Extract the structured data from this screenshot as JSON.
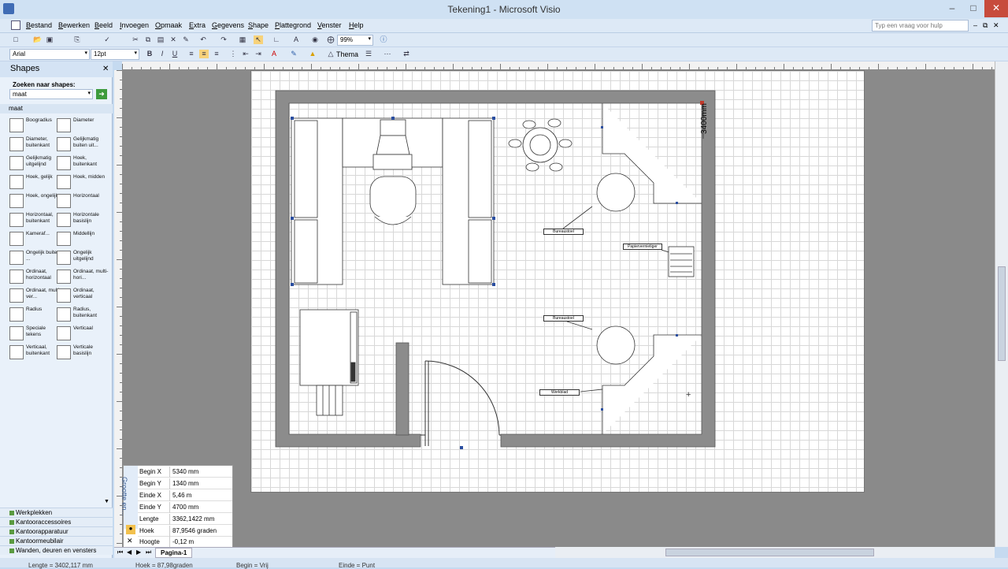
{
  "window": {
    "title": "Tekening1 - Microsoft Visio"
  },
  "menu": {
    "items": [
      "Bestand",
      "Bewerken",
      "Beeld",
      "Invoegen",
      "Opmaak",
      "Extra",
      "Gegevens",
      "Shape",
      "Plattegrond",
      "Venster",
      "Help"
    ],
    "help_placeholder": "Typ een vraag voor hulp"
  },
  "toolbar": {
    "zoom": "99%",
    "font": "Arial",
    "font_size": "12pt",
    "bold": "B",
    "italic": "I",
    "underline": "U",
    "theme": "Thema"
  },
  "shapes_panel": {
    "title": "Shapes",
    "search_label": "Zoeken naar shapes:",
    "search_value": "maat",
    "stencil_name": "maat",
    "items": [
      "Boogradius",
      "Diameter",
      "Diameter, buitenkant",
      "Gelijkmatig buiten uit...",
      "Gelijkmatig uitgelijnd",
      "Hoek, buitenkant",
      "Hoek, gelijk",
      "Hoek, midden",
      "Hoek, ongelijk",
      "Horizontaal",
      "Horizontaal, buitenkant",
      "Horizontale basislijn",
      "Kameraf...",
      "Middellijn",
      "Ongelijk buiten ...",
      "Ongelijk uitgelijnd",
      "Ordinaat, horizontaal",
      "Ordinaat, multi-hori...",
      "Ordinaat, multi-ver...",
      "Ordinaat, verticaal",
      "Radius",
      "Radius, buitenkant",
      "Speciale tekens",
      "Verticaal",
      "Verticaal, buitenkant",
      "Verticale basislijn"
    ],
    "stencils": [
      "Werkplekken",
      "Kantooraccessoires",
      "Kantoorapparatuur",
      "Kantoormeubilair",
      "Wanden, deuren en vensters"
    ]
  },
  "drawing": {
    "labels": {
      "desk1": "Bureaustoel",
      "desk2": "Bureaustoel",
      "shredder": "Papiervernietiger",
      "workbench": "Werkblad",
      "dimension": "3400mm"
    }
  },
  "size_panel": {
    "title": "Grootte en...",
    "rows": [
      {
        "key": "Begin X",
        "value": "5340 mm"
      },
      {
        "key": "Begin Y",
        "value": "1340 mm"
      },
      {
        "key": "Einde X",
        "value": "5,46 m"
      },
      {
        "key": "Einde Y",
        "value": "4700 mm"
      },
      {
        "key": "Lengte",
        "value": "3362,1422 mm"
      },
      {
        "key": "Hoek",
        "value": "87,9546 graden"
      },
      {
        "key": "Hoogte",
        "value": "-0,12 m"
      }
    ]
  },
  "page_tab": "Pagina-1",
  "status": {
    "length": "Lengte = 3402,117 mm",
    "angle": "Hoek = 87,98graden",
    "begin": "Begin = Vrij",
    "end": "Einde = Punt"
  }
}
